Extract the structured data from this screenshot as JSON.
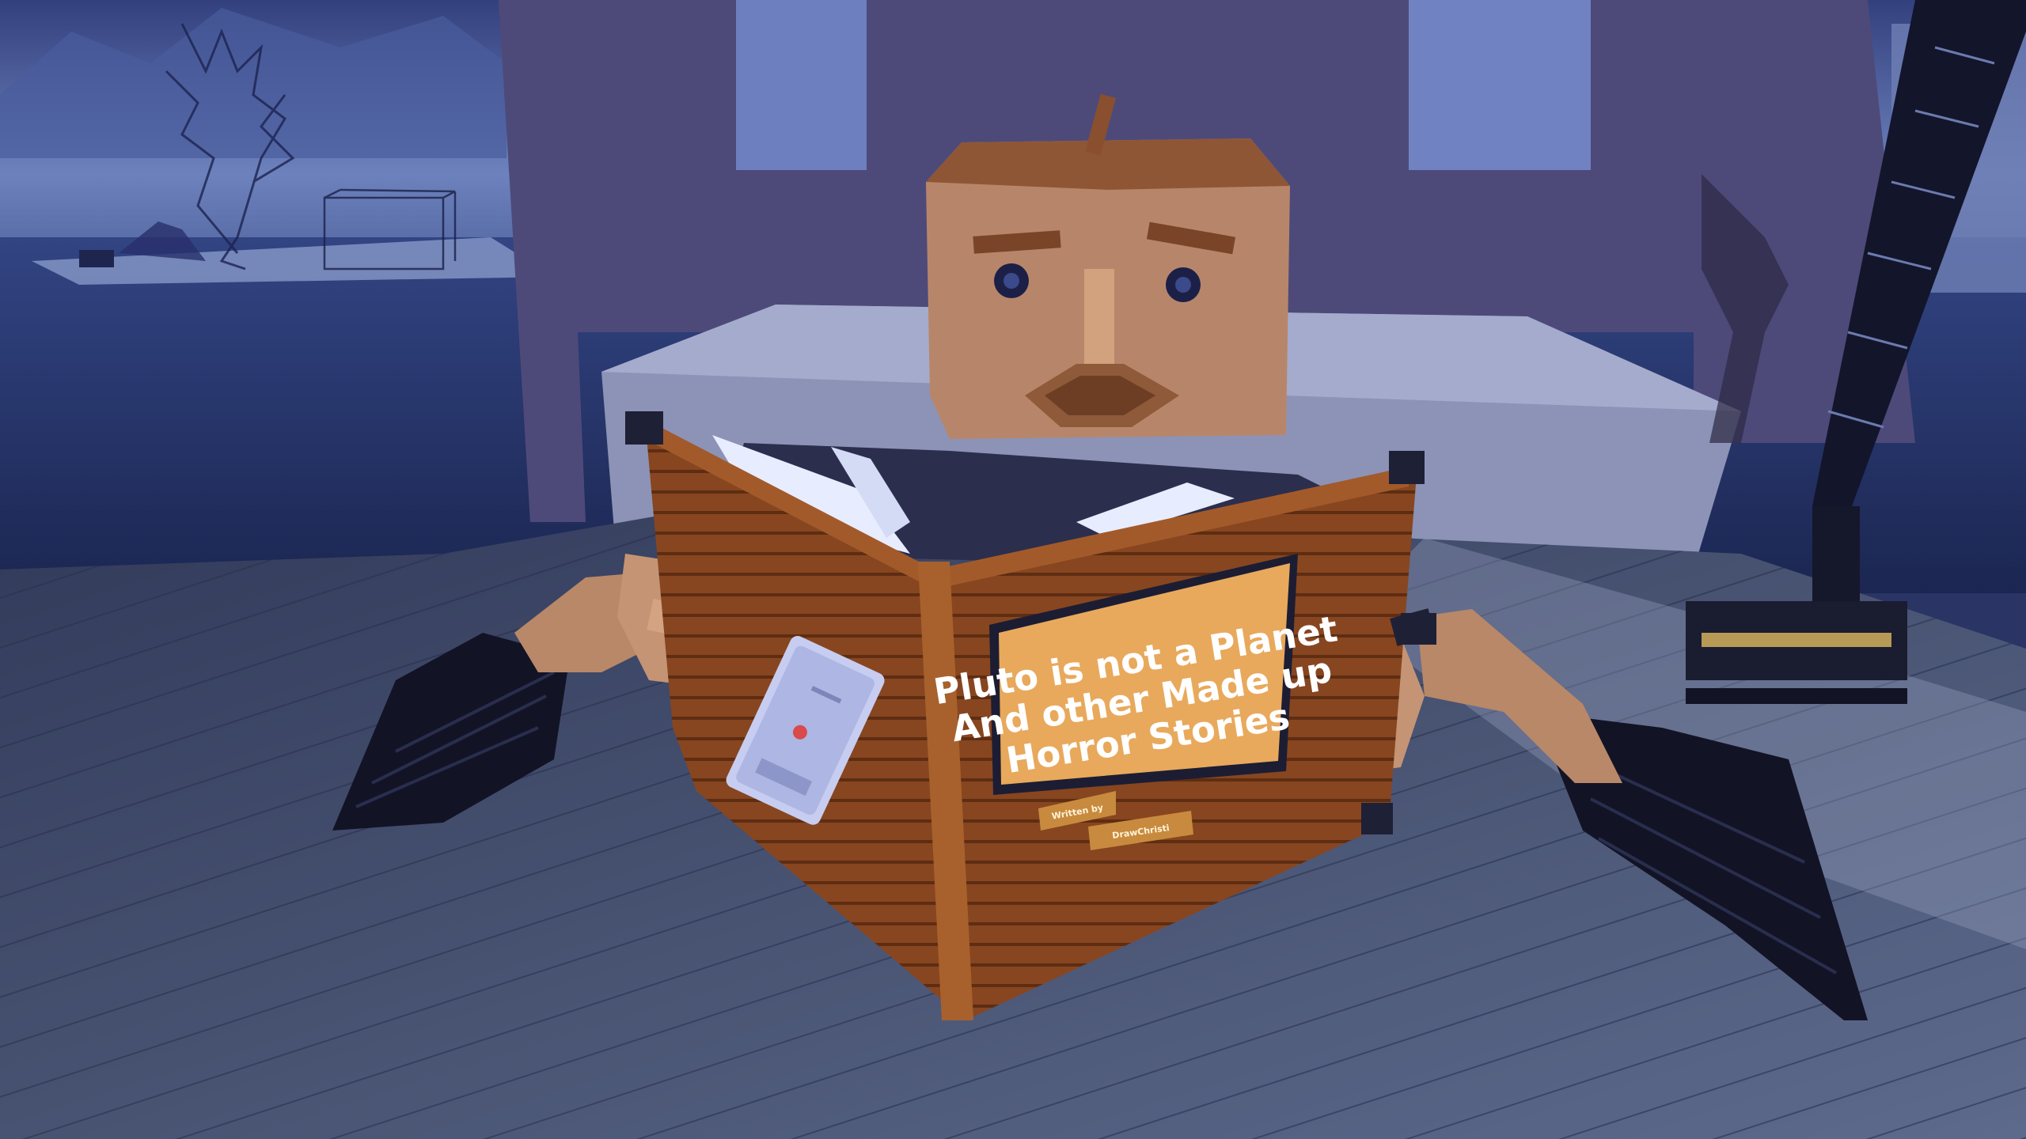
{
  "book": {
    "title_lines": [
      "Pluto is not a Planet",
      "And other Made up",
      "Horror Stories"
    ],
    "written_by_label": "Written by",
    "author": "DrawChristi"
  },
  "scene": {
    "sky_color": "#3f4f93",
    "ground_color": "#3c4566",
    "wall_color": "#4f4a78",
    "wood_color": "#8a4a22",
    "cover_color": "#e8a95c",
    "head_color": "#b7866a"
  }
}
